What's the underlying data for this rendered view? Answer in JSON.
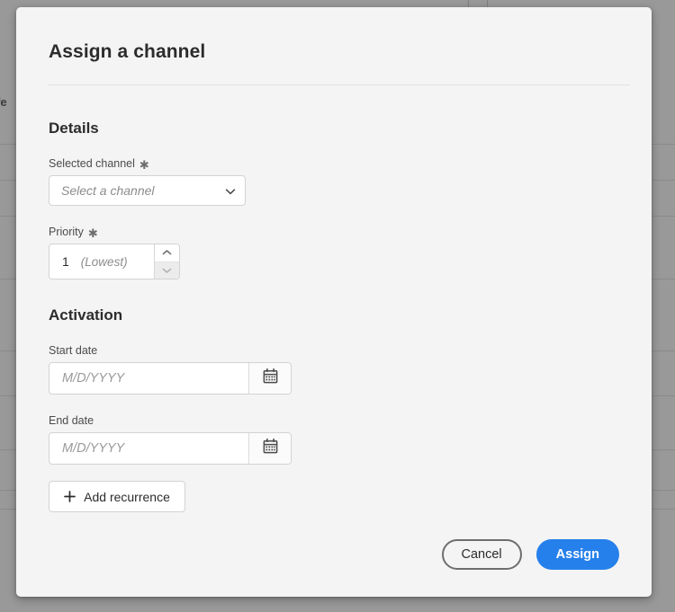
{
  "background": {
    "partial_text": "fe",
    "row_line_positions": [
      160,
      200,
      240,
      310,
      390,
      440,
      500,
      545,
      566
    ],
    "col_line_positions": [
      520,
      541
    ],
    "scrim_color": "#999999"
  },
  "dialog": {
    "title": "Assign a channel",
    "sections": {
      "details": {
        "heading": "Details",
        "selected_channel": {
          "label": "Selected channel",
          "required_marker": "✱",
          "placeholder": "Select a channel",
          "value": "",
          "chevron_icon": "chevron-down-icon"
        },
        "priority": {
          "label": "Priority",
          "required_marker": "✱",
          "value": "1",
          "suffix": "(Lowest)",
          "increment_icon": "chevron-up-icon",
          "decrement_icon": "chevron-down-icon"
        }
      },
      "activation": {
        "heading": "Activation",
        "start_date": {
          "label": "Start date",
          "placeholder": "M/D/YYYY",
          "value": "",
          "calendar_icon": "calendar-icon"
        },
        "end_date": {
          "label": "End date",
          "placeholder": "M/D/YYYY",
          "value": "",
          "calendar_icon": "calendar-icon"
        },
        "add_recurrence": {
          "label": "Add recurrence",
          "icon": "plus-icon"
        }
      }
    },
    "footer": {
      "cancel_label": "Cancel",
      "assign_label": "Assign"
    }
  },
  "colors": {
    "accent_blue": "#2680eb",
    "dialog_background": "#f4f4f4",
    "border_grey": "#d3d3d3",
    "text_primary": "#2c2c2c",
    "text_placeholder": "#8c8c8c"
  }
}
